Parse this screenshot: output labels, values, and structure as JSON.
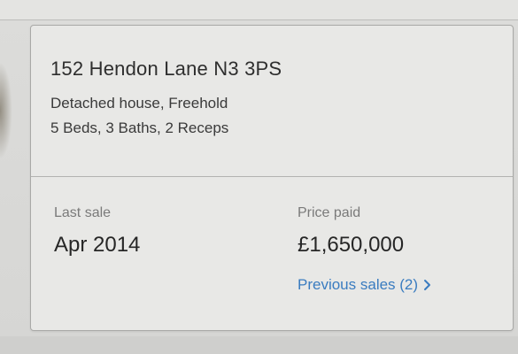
{
  "listing": {
    "address": "152 Hendon Lane N3 3PS",
    "property_type": "Detached house, Freehold",
    "rooms": "5 Beds, 3 Baths, 2 Receps"
  },
  "sale": {
    "last_sale_label": "Last sale",
    "last_sale_value": "Apr 2014",
    "price_paid_label": "Price paid",
    "price_paid_value": "£1,650,000",
    "previous_sales_link": "Previous sales (2)"
  },
  "icons": {
    "previous_sales_chevron": "chevron-right-icon"
  },
  "colors": {
    "link": "#3a7cc0",
    "text_primary": "#2e2e2e",
    "text_secondary": "#7a7a7a",
    "card_background": "#e8e8e6"
  }
}
